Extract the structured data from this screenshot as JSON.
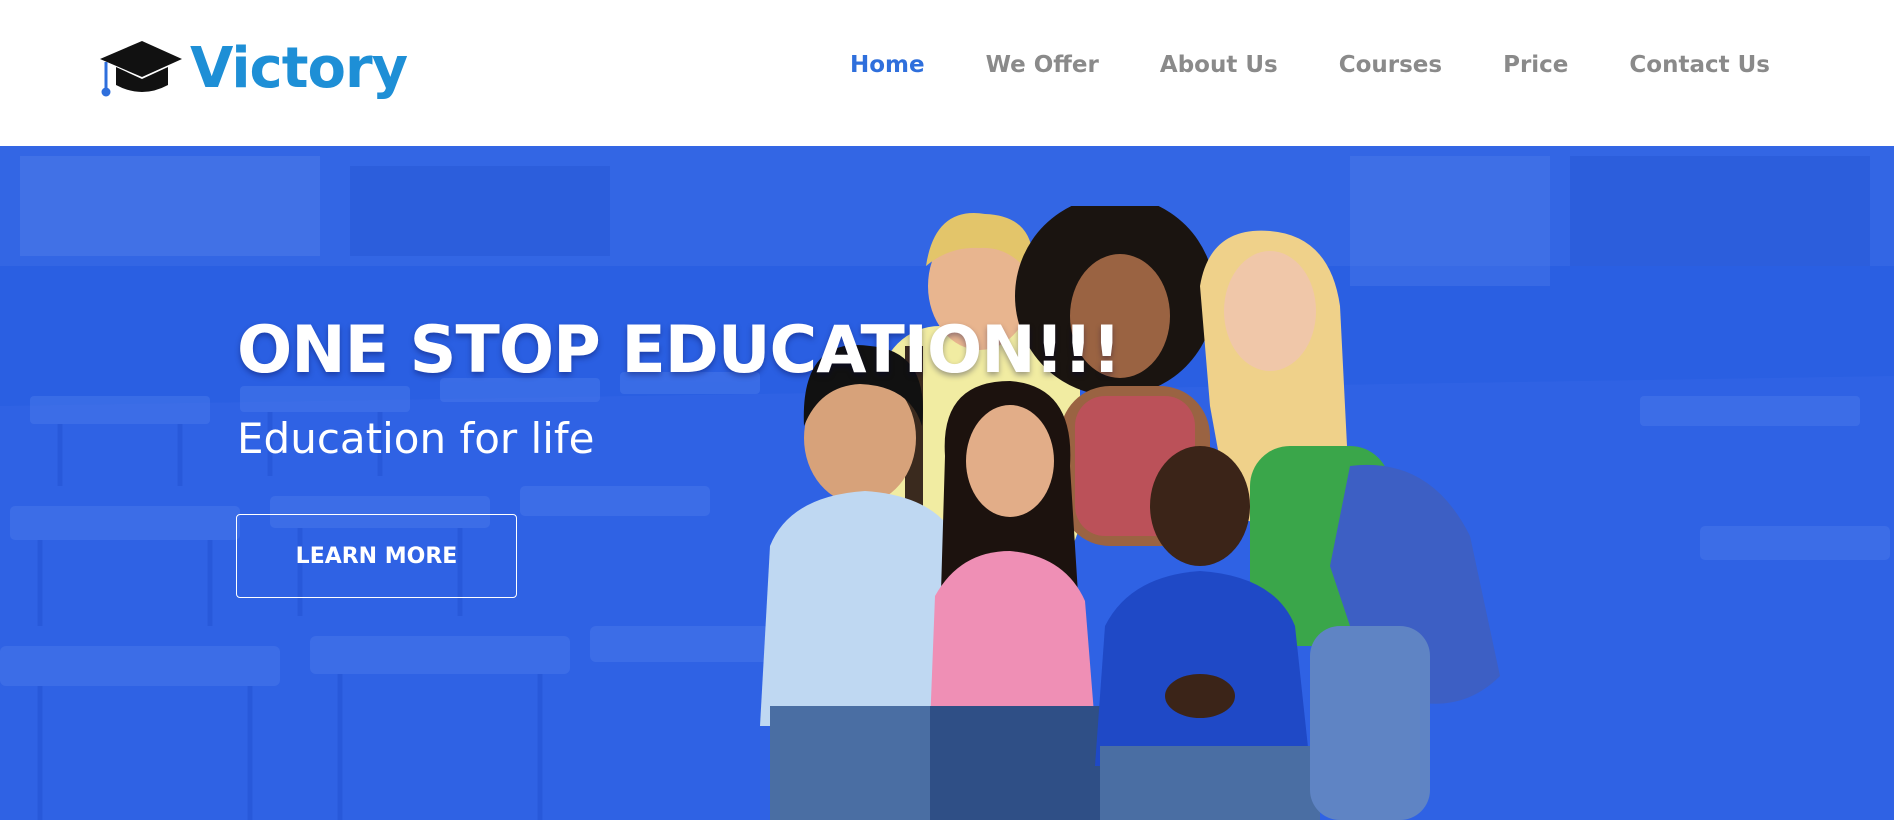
{
  "brand": {
    "name": "Victory",
    "logo_icon": "graduation-cap-icon",
    "color": "#1e8fd6"
  },
  "nav": {
    "items": [
      {
        "label": "Home",
        "active": true
      },
      {
        "label": "We Offer",
        "active": false
      },
      {
        "label": "About Us",
        "active": false
      },
      {
        "label": "Courses",
        "active": false
      },
      {
        "label": "Price",
        "active": false
      },
      {
        "label": "Contact Us",
        "active": false
      }
    ],
    "active_color": "#2f6fdc",
    "inactive_color": "#8a8a8a"
  },
  "hero": {
    "title": "ONE STOP EDUCATION!!!",
    "subtitle": "Education for life",
    "button_label": "LEARN MORE",
    "overlay_color": "#2a5fe2",
    "image": "group-of-students-photo"
  }
}
